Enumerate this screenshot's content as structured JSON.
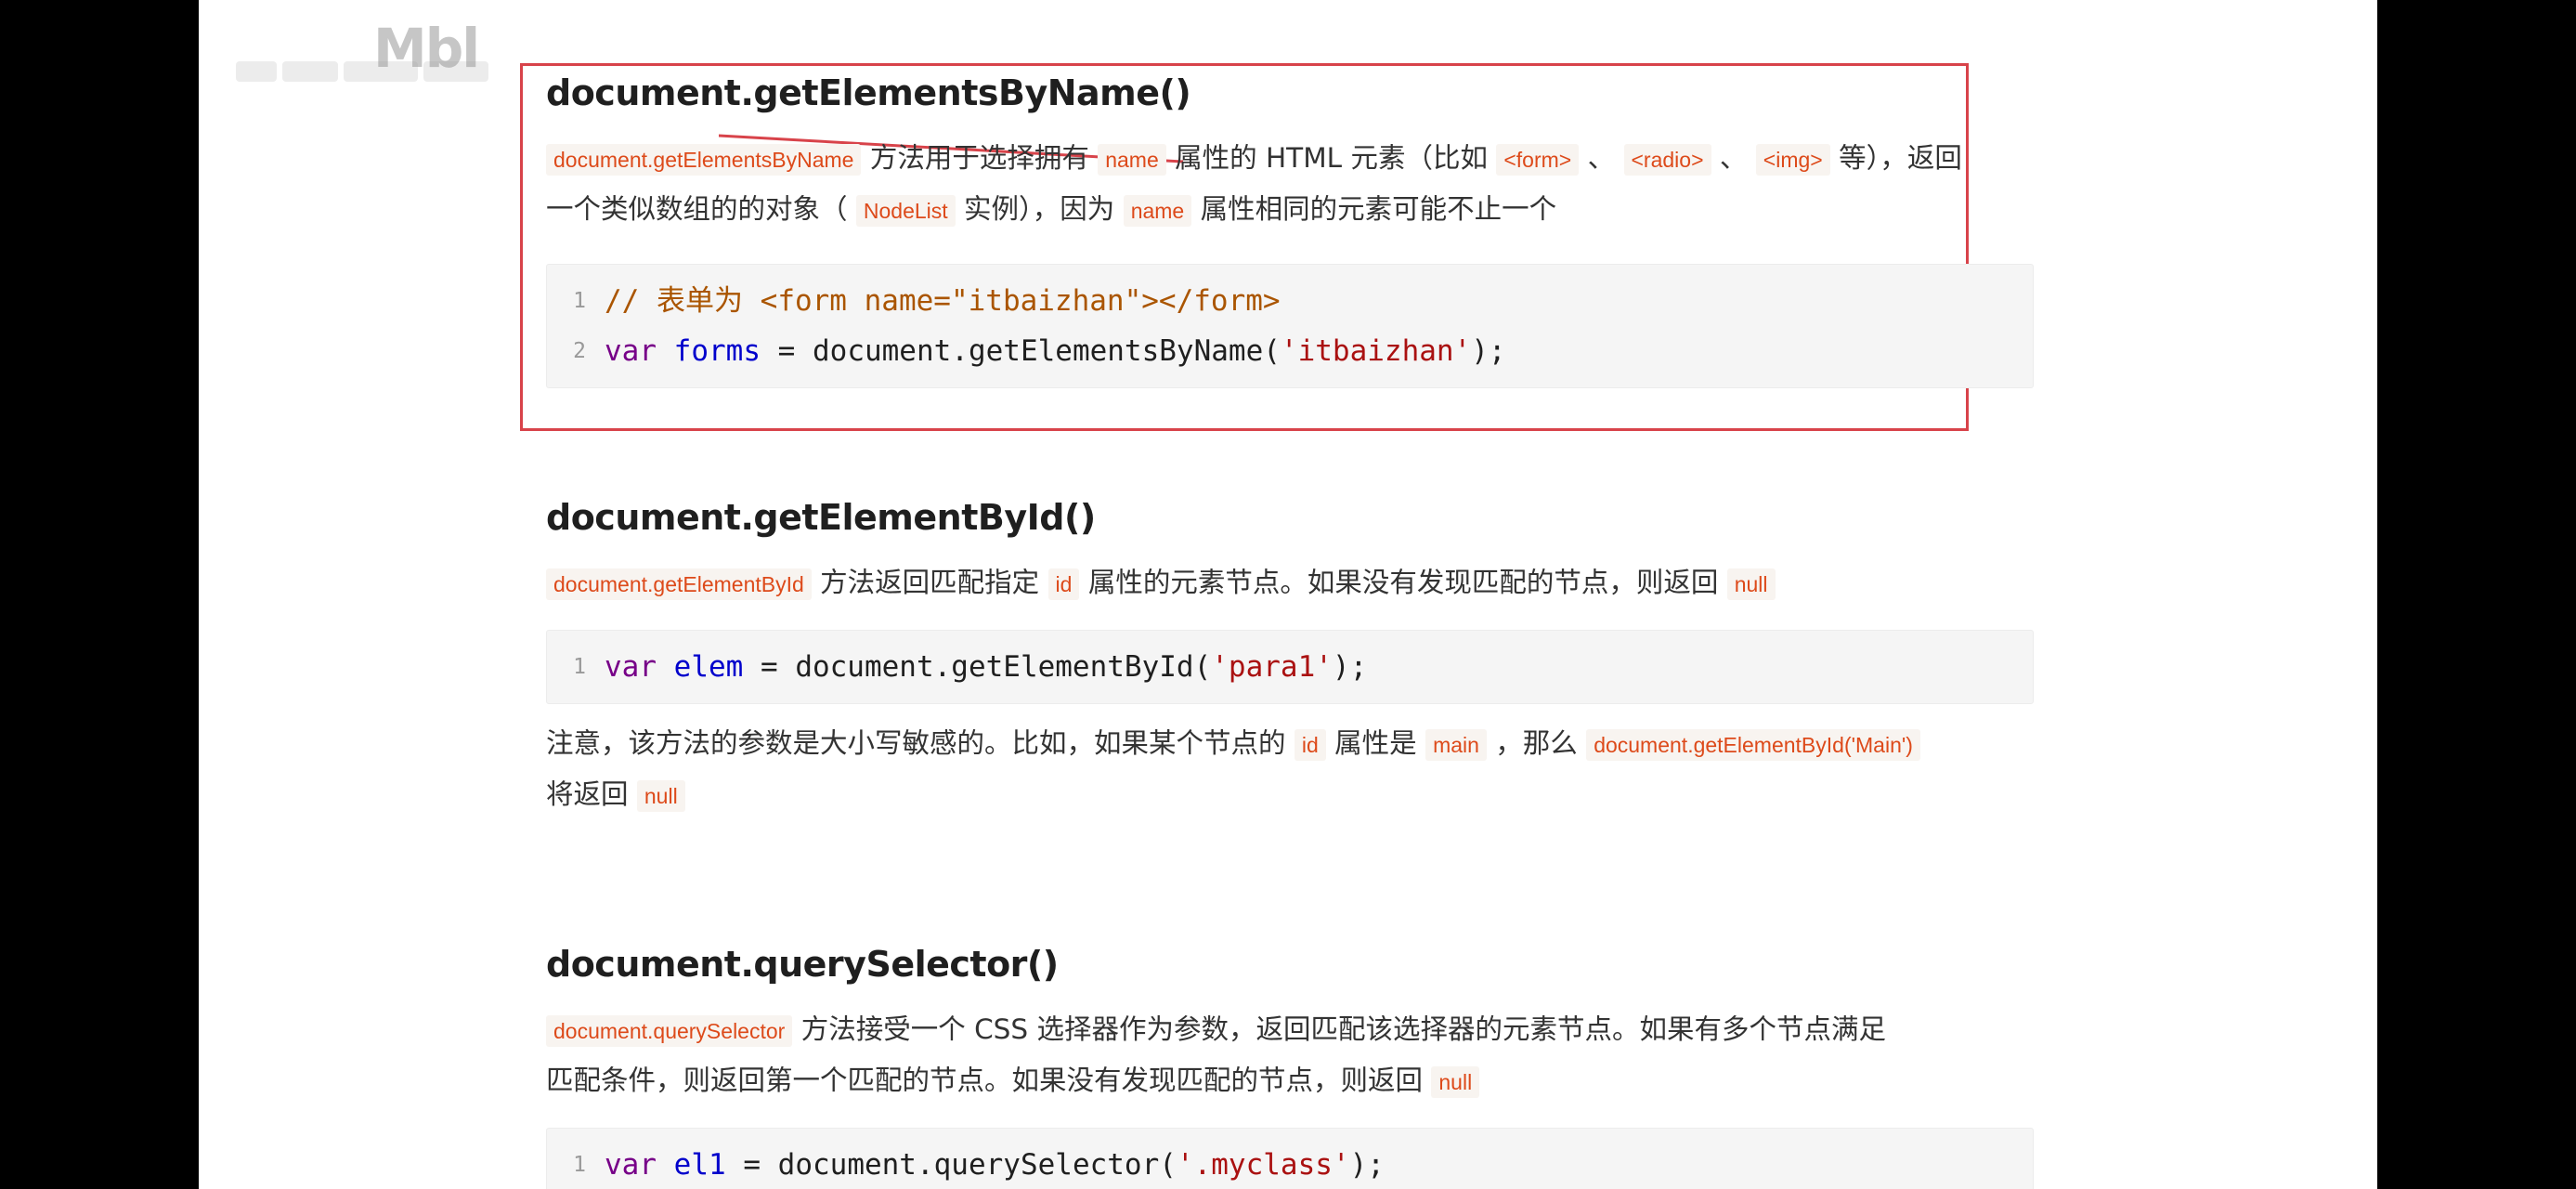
{
  "watermark": "Mbl",
  "colors": {
    "highlight_box": "#d8434a",
    "inline_code": "#dd4a1a",
    "keyword": "#770088",
    "variable": "#0000cc",
    "string": "#aa1111",
    "comment": "#aa5500"
  },
  "sections": [
    {
      "title": "document.getElementsByName()",
      "desc_line1": [
        {
          "t": "code",
          "v": "document.getElementsByName"
        },
        {
          "t": "text",
          "v": " 方法用于选择拥有 "
        },
        {
          "t": "code",
          "v": "name"
        },
        {
          "t": "text",
          "v": " 属性的 HTML 元素（比如 "
        },
        {
          "t": "code",
          "v": "<form>"
        },
        {
          "t": "text",
          "v": " 、 "
        },
        {
          "t": "code",
          "v": "<radio>"
        },
        {
          "t": "text",
          "v": " 、 "
        },
        {
          "t": "code",
          "v": "<img>"
        },
        {
          "t": "text",
          "v": " 等），返回"
        }
      ],
      "desc_line2": [
        {
          "t": "text",
          "v": "一个类似数组的的对象（ "
        },
        {
          "t": "code",
          "v": "NodeList"
        },
        {
          "t": "text",
          "v": " 实例），因为 "
        },
        {
          "t": "code",
          "v": "name"
        },
        {
          "t": "text",
          "v": " 属性相同的元素可能不止一个"
        }
      ],
      "code": [
        {
          "n": "1",
          "html": [
            {
              "c": "cm",
              "v": "// 表单为 <form name=\"itbaizhan\"></form>"
            }
          ]
        },
        {
          "n": "2",
          "html": [
            {
              "c": "kw",
              "v": "var"
            },
            {
              "c": "",
              "v": " "
            },
            {
              "c": "def",
              "v": "forms"
            },
            {
              "c": "",
              "v": " = document.getElementsByName("
            },
            {
              "c": "str",
              "v": "'itbaizhan'"
            },
            {
              "c": "",
              "v": ");"
            }
          ]
        }
      ]
    },
    {
      "title": "document.getElementById()",
      "desc_line1": [
        {
          "t": "code",
          "v": "document.getElementById"
        },
        {
          "t": "text",
          "v": " 方法返回匹配指定 "
        },
        {
          "t": "code",
          "v": "id"
        },
        {
          "t": "text",
          "v": " 属性的元素节点。如果没有发现匹配的节点，则返回 "
        },
        {
          "t": "code",
          "v": "null"
        }
      ],
      "code": [
        {
          "n": "1",
          "html": [
            {
              "c": "kw",
              "v": "var"
            },
            {
              "c": "",
              "v": " "
            },
            {
              "c": "def",
              "v": "elem"
            },
            {
              "c": "",
              "v": " = document.getElementById("
            },
            {
              "c": "str",
              "v": "'para1'"
            },
            {
              "c": "",
              "v": ");"
            }
          ]
        }
      ],
      "note_line1": [
        {
          "t": "text",
          "v": "注意，该方法的参数是大小写敏感的。比如，如果某个节点的 "
        },
        {
          "t": "code",
          "v": "id"
        },
        {
          "t": "text",
          "v": " 属性是 "
        },
        {
          "t": "code",
          "v": "main"
        },
        {
          "t": "text",
          "v": " ，那么 "
        },
        {
          "t": "code",
          "v": "document.getElementById('Main')"
        }
      ],
      "note_line2": [
        {
          "t": "text",
          "v": "将返回 "
        },
        {
          "t": "code",
          "v": "null"
        }
      ]
    },
    {
      "title": "document.querySelector()",
      "desc_line1": [
        {
          "t": "code",
          "v": "document.querySelector"
        },
        {
          "t": "text",
          "v": " 方法接受一个 CSS 选择器作为参数，返回匹配该选择器的元素节点。如果有多个节点满足"
        }
      ],
      "desc_line2": [
        {
          "t": "text",
          "v": "匹配条件，则返回第一个匹配的节点。如果没有发现匹配的节点，则返回 "
        },
        {
          "t": "code",
          "v": "null"
        }
      ],
      "code": [
        {
          "n": "1",
          "html": [
            {
              "c": "kw",
              "v": "var"
            },
            {
              "c": "",
              "v": " "
            },
            {
              "c": "def",
              "v": "el1"
            },
            {
              "c": "",
              "v": " = document.querySelector("
            },
            {
              "c": "str",
              "v": "'.myclass'"
            },
            {
              "c": "",
              "v": ");"
            }
          ]
        }
      ]
    }
  ]
}
